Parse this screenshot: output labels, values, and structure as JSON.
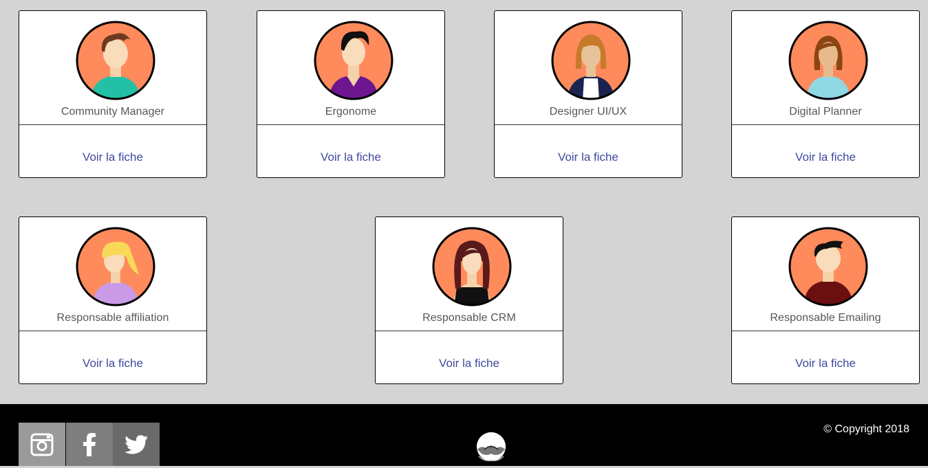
{
  "cards": [
    {
      "role": "Community Manager",
      "link": "Voir la fiche",
      "avatar": "male-avatar-teal-shirt"
    },
    {
      "role": "Ergonome",
      "link": "Voir la fiche",
      "avatar": "male-avatar-purple-shirt"
    },
    {
      "role": "Designer UI/UX",
      "link": "Voir la fiche",
      "avatar": "female-avatar-navy-jacket"
    },
    {
      "role": "Digital Planner",
      "link": "Voir la fiche",
      "avatar": "female-avatar-light-blue-top"
    },
    {
      "role": "Responsable affiliation",
      "link": "Voir la fiche",
      "avatar": "female-avatar-blonde-lilac-top"
    },
    {
      "role": "Responsable CRM",
      "link": "Voir la fiche",
      "avatar": "female-avatar-black-dress"
    },
    {
      "role": "Responsable Emailing",
      "link": "Voir la fiche",
      "avatar": "male-avatar-maroon-shirt"
    }
  ],
  "footer": {
    "social": [
      "instagram-icon",
      "facebook-icon",
      "twitter-icon"
    ],
    "logo": "handshake-logo",
    "copyright": "© Copyright 2018"
  },
  "colors": {
    "page_background": "#d4d4d4",
    "avatar_background": "#ff8a5b",
    "link": "#3f4a9e",
    "footer_background": "#000000"
  }
}
